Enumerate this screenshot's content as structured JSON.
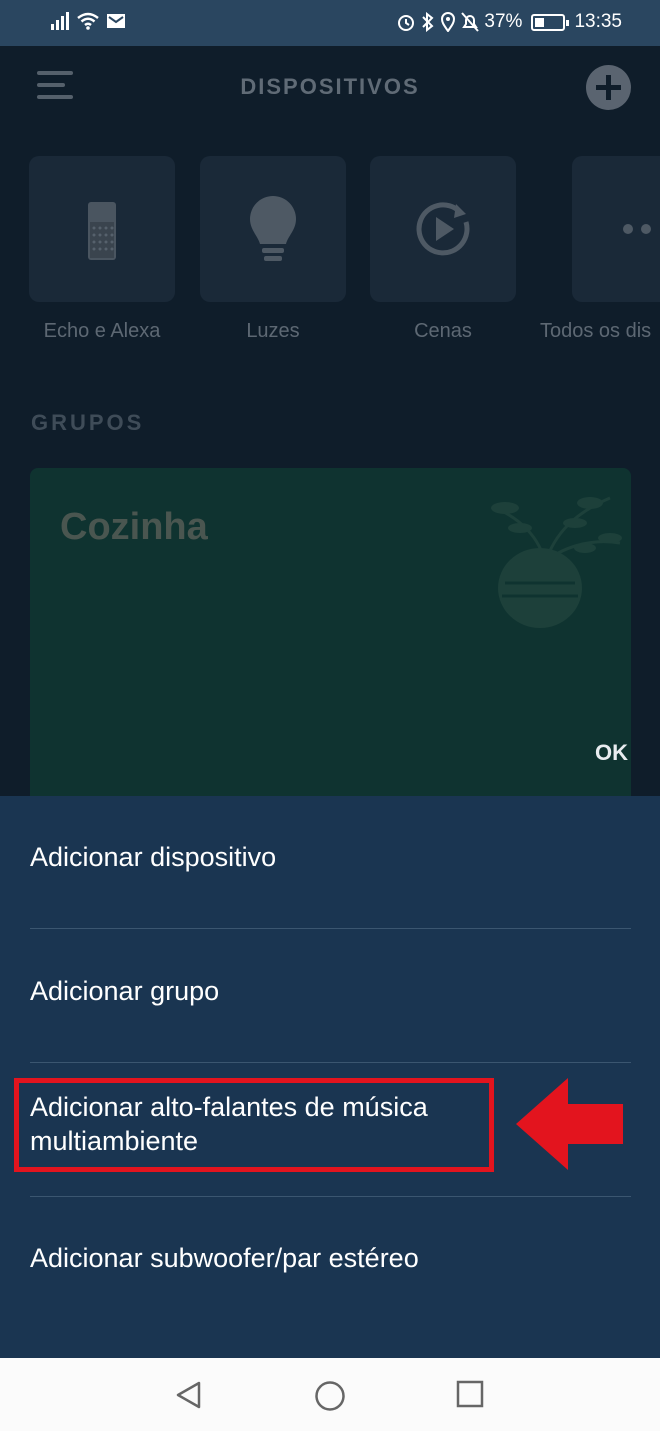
{
  "status_bar": {
    "battery_percent": "37%",
    "time": "13:35"
  },
  "header": {
    "title": "DISPOSITIVOS"
  },
  "categories": [
    {
      "label": "Echo e Alexa",
      "icon": "echo-speaker-icon"
    },
    {
      "label": "Luzes",
      "icon": "bulb-icon"
    },
    {
      "label": "Cenas",
      "icon": "play-refresh-icon"
    },
    {
      "label": "Todos os dis",
      "icon": "more-dots-icon"
    }
  ],
  "groups": {
    "section_label": "GRUPOS",
    "cards": [
      {
        "name": "Cozinha",
        "status": "OK"
      }
    ]
  },
  "sheet": {
    "items": [
      {
        "label": "Adicionar dispositivo"
      },
      {
        "label": "Adicionar grupo"
      },
      {
        "label": "Adicionar alto-falantes de música multiambiente"
      },
      {
        "label": "Adicionar subwoofer/par estéreo"
      }
    ]
  },
  "colors": {
    "highlight_red": "#e3141e",
    "sheet_bg": "#1a3551"
  }
}
